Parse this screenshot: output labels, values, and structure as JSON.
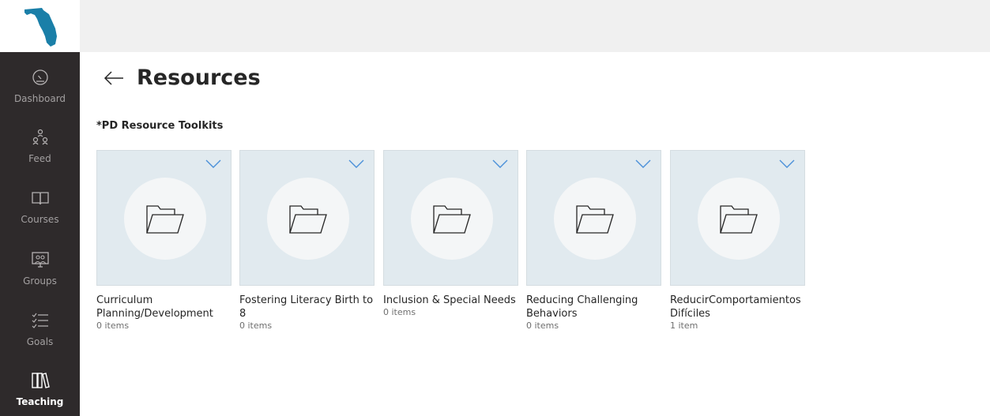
{
  "nav": {
    "items": [
      {
        "label": "Dashboard",
        "icon": "dashboard-icon"
      },
      {
        "label": "Feed",
        "icon": "feed-icon"
      },
      {
        "label": "Courses",
        "icon": "courses-icon"
      },
      {
        "label": "Groups",
        "icon": "groups-icon"
      },
      {
        "label": "Goals",
        "icon": "goals-icon"
      },
      {
        "label": "Teaching",
        "icon": "teaching-icon",
        "active": true
      }
    ]
  },
  "header": {
    "back_icon": "back-arrow-icon",
    "title": "Resources"
  },
  "section": {
    "title": "*PD Resource Toolkits"
  },
  "tiles": [
    {
      "name": "Curriculum Planning/Development",
      "count": "0 items"
    },
    {
      "name": "Fostering Literacy Birth to 8",
      "count": "0 items"
    },
    {
      "name": "Inclusion & Special Needs",
      "count": "0 items"
    },
    {
      "name": "Reducing Challenging Behaviors",
      "count": "0 items"
    },
    {
      "name": "ReducirComportamientos Difíciles",
      "count": "1 item"
    }
  ],
  "colors": {
    "sidebar_bg": "#2e2a2b",
    "topbar_bg": "#f0f0f0",
    "tile_bg": "#e1eaef",
    "chevron": "#4a90d9",
    "logo": "#1a7fa8"
  }
}
